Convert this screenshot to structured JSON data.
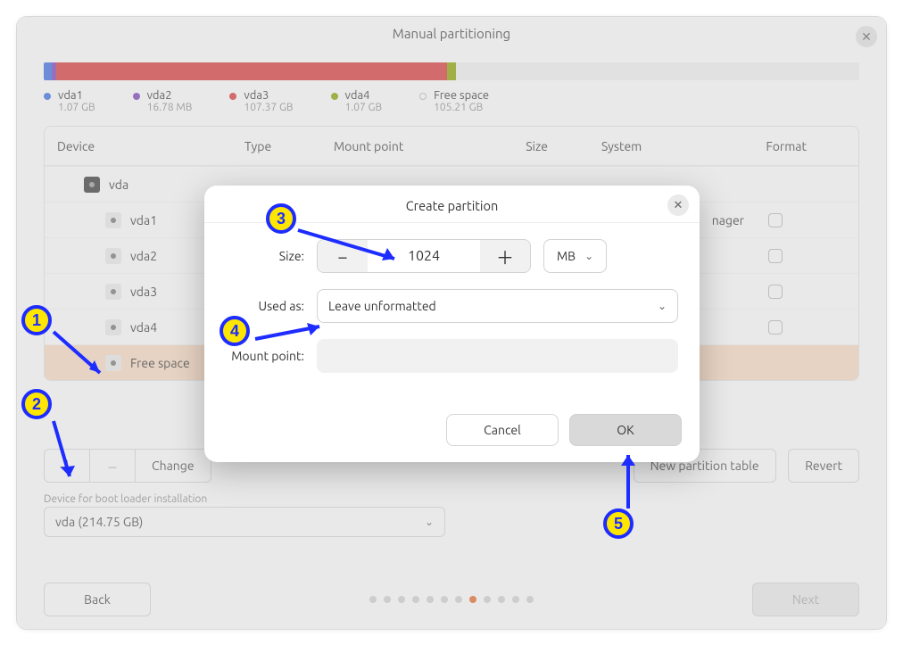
{
  "header": {
    "title": "Manual partitioning"
  },
  "legend": [
    {
      "name": "vda1",
      "size": "1.07 GB",
      "color": "blue"
    },
    {
      "name": "vda2",
      "size": "16.78 MB",
      "color": "purple"
    },
    {
      "name": "vda3",
      "size": "107.37 GB",
      "color": "red"
    },
    {
      "name": "vda4",
      "size": "1.07 GB",
      "color": "olive"
    },
    {
      "name": "Free space",
      "size": "105.21 GB",
      "color": "open"
    }
  ],
  "columns": {
    "device": "Device",
    "type": "Type",
    "mount": "Mount point",
    "size": "Size",
    "system": "System",
    "format": "Format"
  },
  "rows": [
    {
      "name": "vda",
      "indent": 1,
      "dark": true,
      "system": ""
    },
    {
      "name": "vda1",
      "indent": 2,
      "dark": false,
      "system": "",
      "system_tail": "nager",
      "checkbox": true
    },
    {
      "name": "vda2",
      "indent": 2,
      "dark": false,
      "system": "",
      "checkbox": true
    },
    {
      "name": "vda3",
      "indent": 2,
      "dark": false,
      "system": "",
      "checkbox": true
    },
    {
      "name": "vda4",
      "indent": 2,
      "dark": false,
      "system": "",
      "checkbox": true
    },
    {
      "name": "Free space",
      "indent": 2,
      "dark": false,
      "free": true
    }
  ],
  "actions": {
    "change": "Change",
    "new_table": "New partition table",
    "revert": "Revert"
  },
  "bootloader": {
    "label": "Device for boot loader installation",
    "value": "vda  (214.75 GB)"
  },
  "footer": {
    "back": "Back",
    "next": "Next",
    "dots": 12,
    "active": 8
  },
  "modal": {
    "title": "Create partition",
    "size_label": "Size:",
    "size_value": "1024",
    "unit": "MB",
    "used_as_label": "Used as:",
    "used_as_value": "Leave unformatted",
    "mount_label": "Mount point:",
    "cancel": "Cancel",
    "ok": "OK"
  },
  "annotations": [
    "1",
    "2",
    "3",
    "4",
    "5"
  ]
}
